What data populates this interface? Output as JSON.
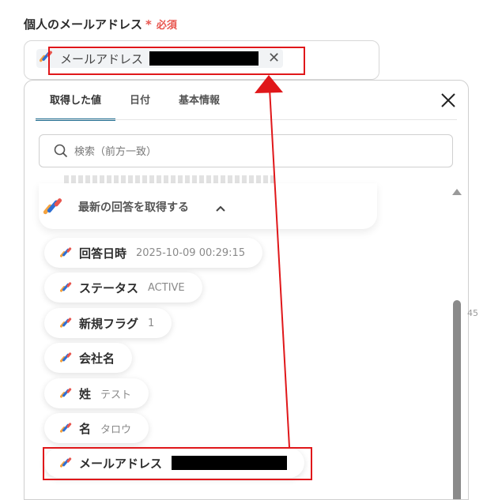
{
  "field": {
    "label": "個人のメールアドレス",
    "required_star": "*",
    "required_text": "必須",
    "selected_chip": "メールアドレス"
  },
  "tabs": [
    "取得した値",
    "日付",
    "基本情報"
  ],
  "search": {
    "placeholder": "検索（前方一致）"
  },
  "group": {
    "title": "最新の回答を取得する"
  },
  "items": [
    {
      "name": "回答日時",
      "value": "2025-10-09 00:29:15"
    },
    {
      "name": "ステータス",
      "value": "ACTIVE"
    },
    {
      "name": "新規フラグ",
      "value": "1"
    },
    {
      "name": "会社名",
      "value": ""
    },
    {
      "name": "姓",
      "value": "テスト"
    },
    {
      "name": "名",
      "value": "タロウ"
    },
    {
      "name": "メールアドレス",
      "value": ""
    }
  ],
  "side_number": "45",
  "colors": {
    "accent": "#1f6d91",
    "required": "#e8554e",
    "annotation": "#e0171a",
    "icon_orange": "#f4a340",
    "icon_blue": "#2d6fd3"
  }
}
